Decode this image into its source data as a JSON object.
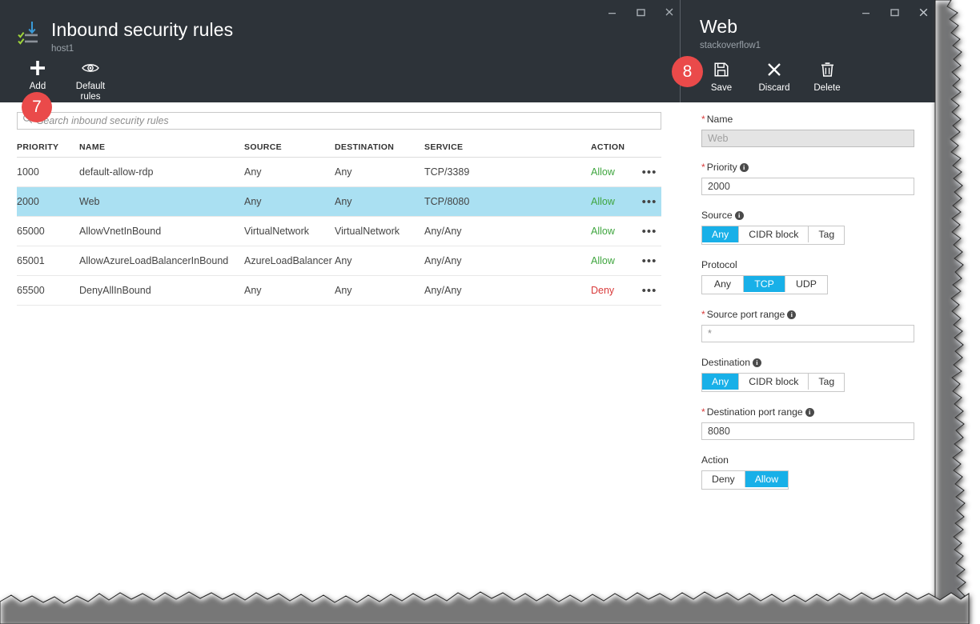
{
  "colors": {
    "chrome": "#2d3339",
    "accent": "#18b0e8",
    "selected_row": "#aae0f2",
    "allow": "#3fa53f",
    "deny": "#d93b3b",
    "badge": "#ea4a4a"
  },
  "left_blade": {
    "title": "Inbound security rules",
    "subtitle": "host1",
    "window_controls": [
      "minimize",
      "maximize",
      "close"
    ],
    "commands": [
      {
        "label": "Add",
        "icon": "plus-icon"
      },
      {
        "label": "Default\nrules",
        "icon": "eye-icon"
      }
    ],
    "step_badge": "7",
    "search": {
      "placeholder": "Search inbound security rules",
      "value": ""
    },
    "table": {
      "columns": [
        "PRIORITY",
        "NAME",
        "SOURCE",
        "DESTINATION",
        "SERVICE",
        "ACTION"
      ],
      "rows": [
        {
          "priority": "1000",
          "name": "default-allow-rdp",
          "source": "Any",
          "destination": "Any",
          "service": "TCP/3389",
          "action": "Allow",
          "action_kind": "allow",
          "menu": "•••",
          "selected": false
        },
        {
          "priority": "2000",
          "name": "Web",
          "source": "Any",
          "destination": "Any",
          "service": "TCP/8080",
          "action": "Allow",
          "action_kind": "allow",
          "menu": "•••",
          "selected": true
        },
        {
          "priority": "65000",
          "name": "AllowVnetInBound",
          "source": "VirtualNetwork",
          "destination": "VirtualNetwork",
          "service": "Any/Any",
          "action": "Allow",
          "action_kind": "allow",
          "menu": "•••",
          "selected": false
        },
        {
          "priority": "65001",
          "name": "AllowAzureLoadBalancerInBound",
          "source": "AzureLoadBalancer",
          "destination": "Any",
          "service": "Any/Any",
          "action": "Allow",
          "action_kind": "allow",
          "menu": "•••",
          "selected": false
        },
        {
          "priority": "65500",
          "name": "DenyAllInBound",
          "source": "Any",
          "destination": "Any",
          "service": "Any/Any",
          "action": "Deny",
          "action_kind": "deny",
          "menu": "•••",
          "selected": false
        }
      ]
    }
  },
  "right_blade": {
    "title": "Web",
    "subtitle": "stackoverflow1",
    "window_controls": [
      "minimize",
      "maximize",
      "close"
    ],
    "step_badge": "8",
    "commands": [
      {
        "label": "Save",
        "icon": "save-icon"
      },
      {
        "label": "Discard",
        "icon": "discard-x-icon"
      },
      {
        "label": "Delete",
        "icon": "trash-icon"
      }
    ],
    "form": {
      "name": {
        "label": "Name",
        "required": true,
        "info": false,
        "value": "Web",
        "disabled": true
      },
      "priority": {
        "label": "Priority",
        "required": true,
        "info": true,
        "value": "2000",
        "disabled": false
      },
      "source": {
        "label": "Source",
        "required": false,
        "info": true,
        "options": [
          "Any",
          "CIDR block",
          "Tag"
        ],
        "selected": "Any"
      },
      "protocol": {
        "label": "Protocol",
        "required": false,
        "info": false,
        "options": [
          "Any",
          "TCP",
          "UDP"
        ],
        "selected": "TCP"
      },
      "source_port_range": {
        "label": "Source port range",
        "required": true,
        "info": true,
        "value": "*",
        "disabled": false
      },
      "destination": {
        "label": "Destination",
        "required": false,
        "info": true,
        "options": [
          "Any",
          "CIDR block",
          "Tag"
        ],
        "selected": "Any"
      },
      "destination_port_range": {
        "label": "Destination port range",
        "required": true,
        "info": true,
        "value": "8080",
        "disabled": false
      },
      "action": {
        "label": "Action",
        "required": false,
        "info": false,
        "options": [
          "Deny",
          "Allow"
        ],
        "selected": "Allow"
      }
    }
  }
}
